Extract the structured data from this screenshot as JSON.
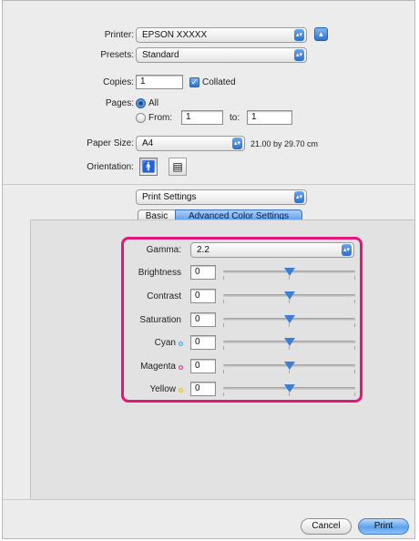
{
  "printer": {
    "label": "Printer:",
    "value": "EPSON XXXXX"
  },
  "presets": {
    "label": "Presets:",
    "value": "Standard"
  },
  "copies": {
    "label": "Copies:",
    "value": "1",
    "collated_label": "Collated"
  },
  "pages": {
    "label": "Pages:",
    "all_label": "All",
    "from_label": "From:",
    "from_value": "1",
    "to_label": "to:",
    "to_value": "1"
  },
  "paper_size": {
    "label": "Paper Size:",
    "value": "A4",
    "dimensions": "21.00 by 29.70 cm"
  },
  "orientation": {
    "label": "Orientation:"
  },
  "panel_select": {
    "value": "Print Settings"
  },
  "tabs": [
    {
      "label": "Basic",
      "selected": false
    },
    {
      "label": "Advanced Color Settings",
      "selected": true
    }
  ],
  "gamma": {
    "label": "Gamma:",
    "value": "2.2"
  },
  "adjustments": [
    {
      "label": "Brightness",
      "value": "0",
      "slider": 0.5
    },
    {
      "label": "Contrast",
      "value": "0",
      "slider": 0.5
    },
    {
      "label": "Saturation",
      "value": "0",
      "slider": 0.5
    },
    {
      "label": "Cyan",
      "value": "0",
      "slider": 0.5,
      "color": "#3aa9e0"
    },
    {
      "label": "Magenta",
      "value": "0",
      "slider": 0.5,
      "color": "#d63a9a"
    },
    {
      "label": "Yellow",
      "value": "0",
      "slider": 0.5,
      "color": "#e2c52a"
    }
  ],
  "buttons": {
    "cancel": "Cancel",
    "print": "Print"
  },
  "colors": {
    "highlight": "#e0187b",
    "accent": "#3d7ed6"
  }
}
